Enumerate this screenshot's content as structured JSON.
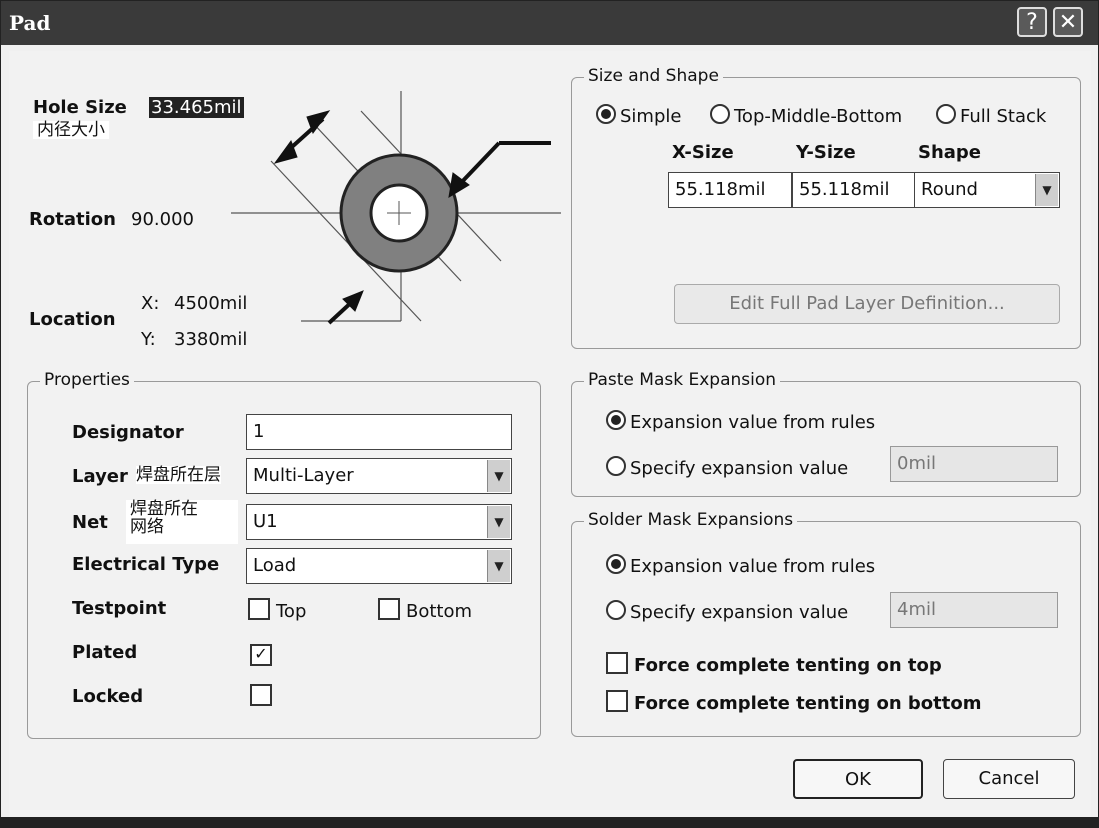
{
  "window": {
    "title": "Pad",
    "help_label": "?",
    "close_label": "✕"
  },
  "top": {
    "hole_size_label": "Hole Size",
    "hole_size_value": "33.465mil",
    "hole_size_cn": "内径大小",
    "rotation_label": "Rotation",
    "rotation_value": "90.000",
    "location_label": "Location",
    "x_label": "X:",
    "x_value": "4500mil",
    "y_label": "Y:",
    "y_value": "3380mil"
  },
  "size_shape": {
    "legend": "Size and Shape",
    "radios": [
      "Simple",
      "Top-Middle-Bottom",
      "Full Stack"
    ],
    "selected": "Simple",
    "col_x": "X-Size",
    "col_y": "Y-Size",
    "col_shape": "Shape",
    "x_size": "55.118mil",
    "y_size": "55.118mil",
    "shape": "Round",
    "edit_button": "Edit Full Pad Layer Definition..."
  },
  "properties": {
    "legend": "Properties",
    "designator_label": "Designator",
    "designator_value": "1",
    "layer_label": "Layer",
    "layer_cn": "焊盘所在层",
    "layer_value": "Multi-Layer",
    "net_label": "Net",
    "net_cn_1": "焊盘所在",
    "net_cn_2": "网络",
    "net_value": "U1",
    "etype_label": "Electrical Type",
    "etype_value": "Load",
    "testpoint_label": "Testpoint",
    "tp_top": "Top",
    "tp_bottom": "Bottom",
    "plated_label": "Plated",
    "locked_label": "Locked",
    "plated_checked": true,
    "locked_checked": false
  },
  "paste": {
    "legend": "Paste Mask Expansion",
    "opt1": "Expansion value from rules",
    "opt2": "Specify expansion value",
    "value": "0mil"
  },
  "solder": {
    "legend": "Solder Mask Expansions",
    "opt1": "Expansion value from rules",
    "opt2": "Specify expansion value",
    "value": "4mil",
    "tent_top": "Force complete tenting on top",
    "tent_bottom": "Force complete tenting on bottom"
  },
  "buttons": {
    "ok": "OK",
    "cancel": "Cancel"
  }
}
